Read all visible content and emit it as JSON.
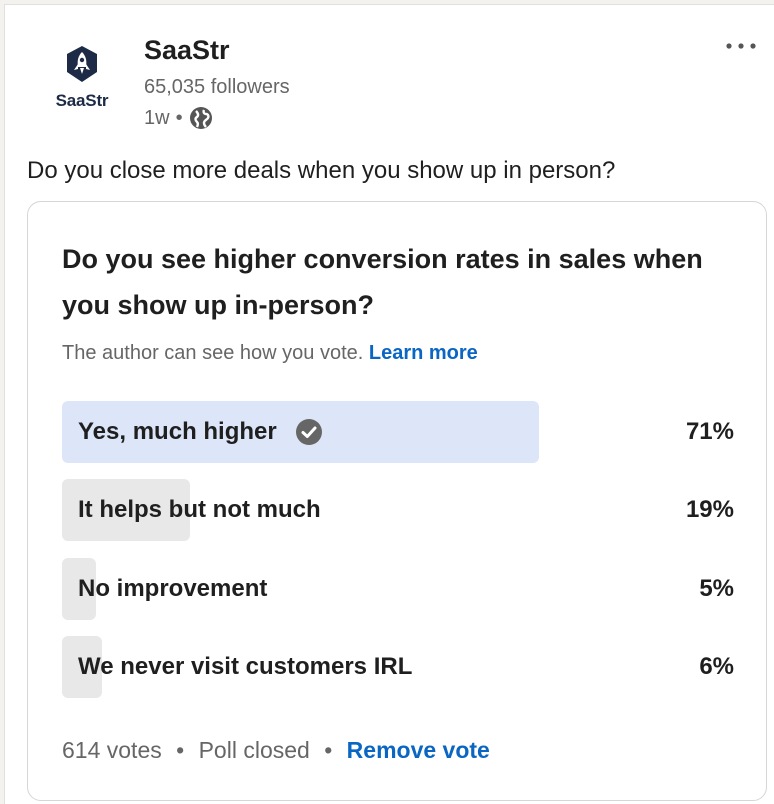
{
  "author": {
    "logo_text": "SaaStr",
    "name": "SaaStr",
    "followers": "65,035 followers",
    "time": "1w",
    "visibility_icon": "globe-icon"
  },
  "post": {
    "text": "Do you close more deals when you show up in person?",
    "menu_icon": "more-options-icon"
  },
  "poll": {
    "question": "Do you see higher conversion rates in sales when you show up in-person?",
    "note": "The author can see how you vote.",
    "learn_more": "Learn more",
    "options": [
      {
        "label": "Yes, much higher",
        "percent": "71%",
        "value": 71,
        "selected": true
      },
      {
        "label": "It helps but not much",
        "percent": "19%",
        "value": 19,
        "selected": false
      },
      {
        "label": "No improvement",
        "percent": "5%",
        "value": 5,
        "selected": false
      },
      {
        "label": "We never visit customers IRL",
        "percent": "6%",
        "value": 6,
        "selected": false
      }
    ],
    "votes": "614 votes",
    "status": "Poll closed",
    "remove_vote": "Remove vote"
  },
  "colors": {
    "link": "#0a66c2",
    "selected_fill": "#dce6f8",
    "unselected_fill": "#e8e8e8",
    "logo": "#1e2b46"
  }
}
